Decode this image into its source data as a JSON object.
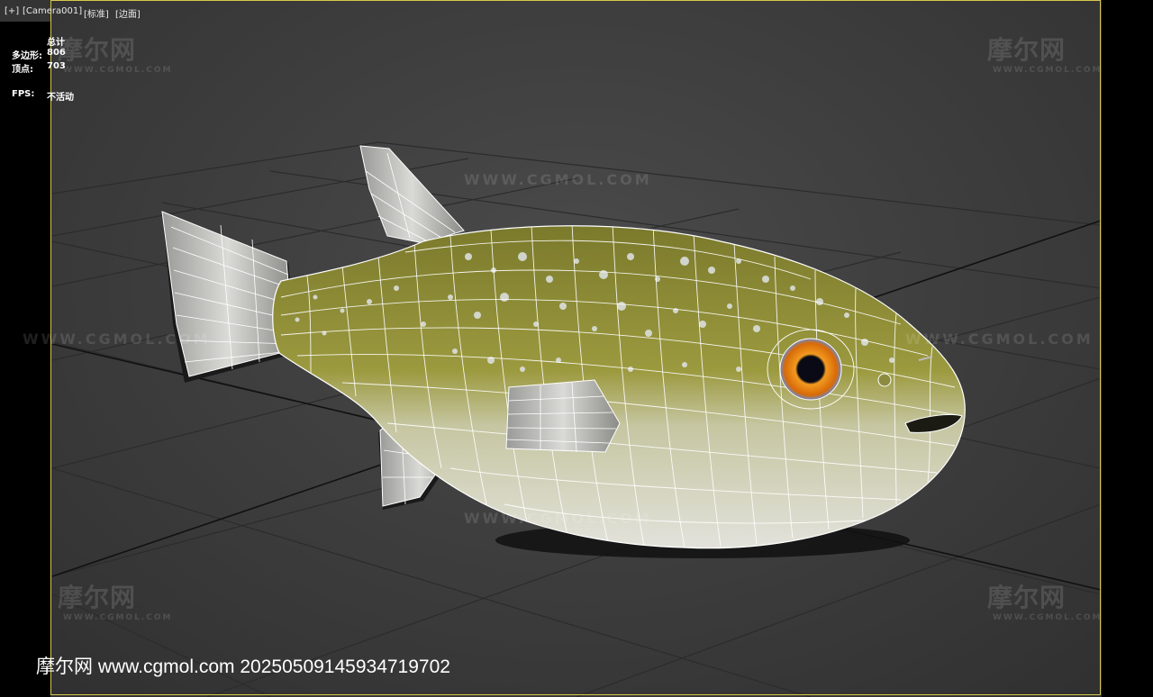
{
  "viewport": {
    "labels": [
      "[+]",
      "[Camera001]",
      "[标准]",
      "[边面]"
    ],
    "stats": {
      "total_label": "总计",
      "polygons_label": "多边形:",
      "polygons_value": "806",
      "vertices_label": "顶点:",
      "vertices_value": "703",
      "fps_label": "FPS:",
      "fps_value": "不活动"
    }
  },
  "watermark": {
    "logo_text": "摩尔网",
    "logo_sub": "WWW.CGMOL.COM",
    "url_text": "WWW.CGMOL.COM",
    "bottom_text": "摩尔网 www.cgmol.com 20250509145934719702"
  },
  "colors": {
    "frame": "#d8c84a",
    "grid": "#2a2a2a",
    "fish_back": "#8c8a35",
    "fish_belly": "#dcdcd2",
    "eye_iris": "#e07a10"
  },
  "icons": [
    "axis-gizmo-icon"
  ]
}
